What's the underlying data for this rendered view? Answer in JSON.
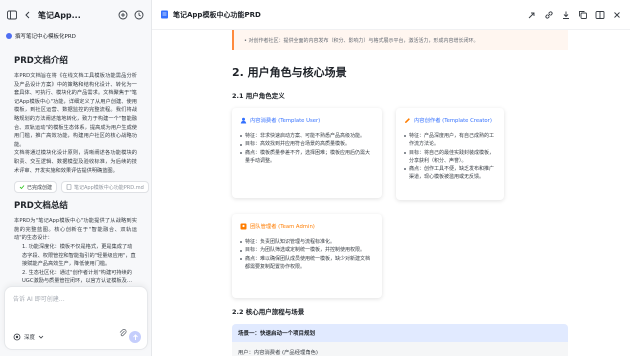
{
  "left": {
    "title": "笔记App...",
    "user_message": "撰写笔记中心模板化PRD",
    "section1": {
      "heading": "PRD文档介绍",
      "paragraph": "本PRD文档旨在将《在线文档工具模板功能需品分析及产品设计方案》中的策略和结构化设计、转化为一套具体、可执行、模块化的产品需求。文档聚焦于\"笔记App模板中心\"功能，详细定义了从用户创建、使用模板，到社区运营、数据监控的完整流程。我们将战略规划的方法阐述落地转化，致力于构建一个\"智能融合、双轨运动\"的模板生态体系，提高成为用户生成使用门槛，推广高效功能，构建用户社区的核心战略功能。",
      "paragraph2": "文档将通过模块化设计原则，清晰阐述各功能模块的职责、交互逻辑、数据模型及验收标准，为后续的技术评审、开发实施和效果评估提供明确蓝图。"
    },
    "chips": [
      "已完成创建",
      "笔记App模板中心功能PRD.md"
    ],
    "section2": {
      "heading": "PRD文档总结",
      "paragraph": "本PRD为\"笔记App模板中心\"功能提供了从战略到实施的完整蓝图。核心创新在于\"智能融合、双轨运动\"的生态设计：",
      "items": [
        "1. 功能深度化：模板不仅是格式，更是集成了动态字段、权限管控和智能指引的\"轻量级应用\"，直接赋能产品高效生产，降低使用门槛。",
        "2. 生态社区化：通过\"创作者计划\"构建可持续的UGC激励与质量管控闭环，以官方认证模板及…"
      ]
    },
    "input_placeholder": "告诉 AI 即可创建…",
    "depth_label": "深度"
  },
  "right": {
    "doc_title": "笔记App模板中心功能PRD",
    "callout": "• 对创作者社区：提供全面的内容发布（积分、影响力）与格式展示平台，激活活力，形成内容增长闭环。",
    "h2": "2. 用户角色与核心场景",
    "h3_roles": "2.1 用户角色定义",
    "cards": [
      {
        "title": "内容消费者 (Template User)",
        "items": [
          "特征：非求快速启动方案、可能不熟悉产品高级功能。",
          "目标：高效找到并应用符合场景的高质量模板。",
          "痛点：模板质量参差不齐，选择困难；模板应用后仍需大量手动调整。"
        ]
      },
      {
        "title": "内容创作者 (Template Creator)",
        "items": [
          "特征：产品深度用户，有自己成熟的工作流方法论。",
          "目标：将自己的最佳实践封装成模板，分享获利（积分、声誉）。",
          "痛点：创作工具不便，缺乏发布和推广渠道，现心模板被滥用或无反馈。"
        ]
      },
      {
        "title": "团队管理者 (Team Admin)",
        "items": [
          "特征：负责团队知识管理与流程标准化。",
          "目标：为团队筛选或定制统一模板，并控制使用权限。",
          "痛点：难以确保团队成员使用统一模板，缺少对新建文档都需要复制配置协作权限。"
        ]
      }
    ],
    "h3_flows": "2.2 核心用户旅程与场景",
    "scene": {
      "title": "场景一：快速启动一个项目规划",
      "body": "用户：内容消费者 (产品经理角色)"
    }
  },
  "colors": {
    "accent": "#3370ff",
    "orange": "#ff7d00",
    "callout_bg": "#fff6f0",
    "scene_header": "#e1eaff"
  }
}
